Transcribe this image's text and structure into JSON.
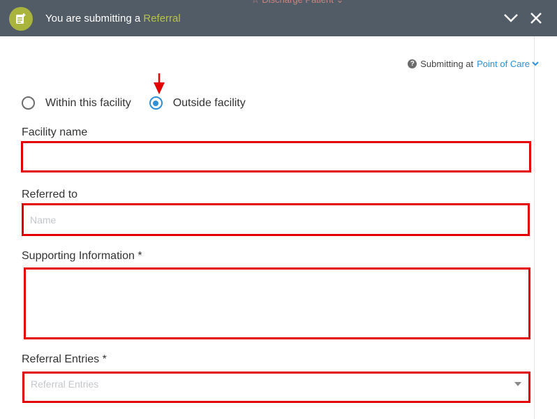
{
  "header": {
    "title_prefix": "You are submitting a",
    "title_accent": "Referral",
    "peek_text": "☆  Discharge Patient  ⌄"
  },
  "submitting": {
    "label": "Submitting at",
    "value": "Point of Care"
  },
  "facility_choice": {
    "options": [
      "Within this facility",
      "Outside facility"
    ],
    "selected": "Outside facility"
  },
  "form": {
    "facility_name_label": "Facility name",
    "facility_name_value": "",
    "referred_to_label": "Referred to",
    "referred_to_placeholder": "Name",
    "supporting_info_label": "Supporting Information *",
    "supporting_info_value": "",
    "referral_entries_label": "Referral Entries *",
    "referral_entries_placeholder": "Referral Entries"
  },
  "colors": {
    "header_bg": "#525c66",
    "accent": "#b7c24a",
    "link": "#2f8fd8",
    "highlight": "#e20000"
  }
}
